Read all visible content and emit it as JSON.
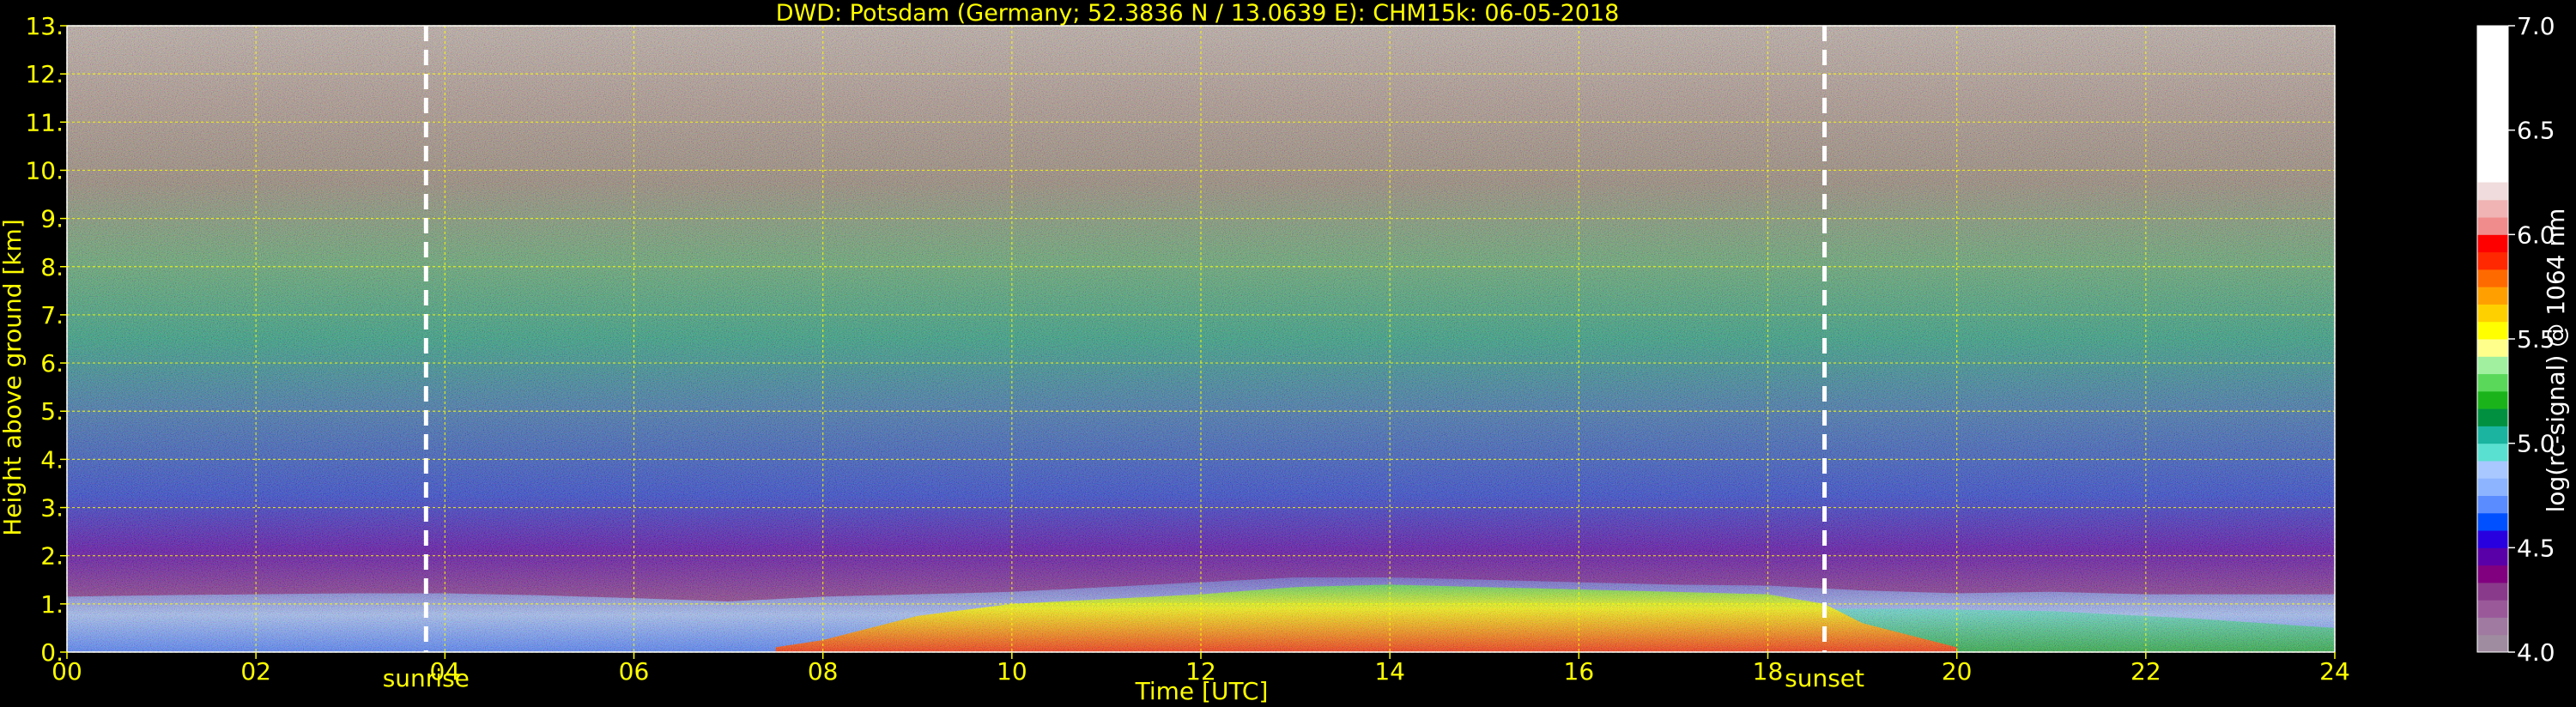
{
  "chart_data": {
    "type": "heatmap",
    "title": "DWD: Potsdam (Germany; 52.3836 N / 13.0639 E):    CHM15k: 06-05-2018",
    "xlabel": "Time [UTC]",
    "ylabel": "Height above ground [km]",
    "xlim": [
      0,
      24
    ],
    "ylim": [
      0,
      13
    ],
    "x_ticks": [
      "00",
      "02",
      "04",
      "06",
      "08",
      "10",
      "12",
      "14",
      "16",
      "18",
      "20",
      "22",
      "24"
    ],
    "y_ticks": [
      "0.",
      "1.",
      "2.",
      "3.",
      "4.",
      "5.",
      "6.",
      "7.",
      "8.",
      "9.",
      "10.",
      "11.",
      "12.",
      "13."
    ],
    "grid": true,
    "grid_color": "#ffff00",
    "events": [
      {
        "label": "sunrise",
        "time": 3.8
      },
      {
        "label": "sunset",
        "time": 18.6
      }
    ],
    "colorbar": {
      "label": "log(rc-signal) @ 1064 nm",
      "min": 4.0,
      "max": 7.0,
      "ticks": [
        "4.0",
        "4.5",
        "5.0",
        "5.5",
        "6.0",
        "6.5",
        "7.0"
      ],
      "colors": [
        "#a08ca0",
        "#a07aa0",
        "#9a5a9a",
        "#8a3a8a",
        "#800080",
        "#5a00a8",
        "#2800e0",
        "#0050ff",
        "#5a8cff",
        "#8cb4ff",
        "#a8c8ff",
        "#5ae0d0",
        "#1ab4a0",
        "#009040",
        "#1ab41a",
        "#5ad85a",
        "#a0f0a0",
        "#ffff8c",
        "#ffff00",
        "#ffd000",
        "#ffa000",
        "#ff6a00",
        "#ff2800",
        "#ff0000",
        "#f08c8c",
        "#f0b4b4",
        "#f0dcdc",
        "#ffffff"
      ]
    },
    "boundary_layer_top_km": [
      [
        0,
        1.15
      ],
      [
        1,
        1.18
      ],
      [
        2,
        1.2
      ],
      [
        3,
        1.22
      ],
      [
        4,
        1.22
      ],
      [
        5,
        1.18
      ],
      [
        6,
        1.12
      ],
      [
        7,
        1.05
      ],
      [
        8,
        1.15
      ],
      [
        9,
        1.2
      ],
      [
        10,
        1.25
      ],
      [
        11,
        1.35
      ],
      [
        12,
        1.45
      ],
      [
        13,
        1.55
      ],
      [
        14,
        1.55
      ],
      [
        15,
        1.5
      ],
      [
        16,
        1.45
      ],
      [
        17,
        1.4
      ],
      [
        18,
        1.38
      ],
      [
        19,
        1.28
      ],
      [
        20,
        1.22
      ],
      [
        21,
        1.25
      ],
      [
        22,
        1.2
      ],
      [
        23,
        1.2
      ],
      [
        24,
        1.2
      ]
    ],
    "mixing_layer_strong_signal_km": [
      [
        7.5,
        0.1
      ],
      [
        8,
        0.25
      ],
      [
        8.5,
        0.5
      ],
      [
        9,
        0.75
      ],
      [
        10,
        1.0
      ],
      [
        11,
        1.1
      ],
      [
        12,
        1.2
      ],
      [
        13,
        1.35
      ],
      [
        14,
        1.4
      ],
      [
        15,
        1.35
      ],
      [
        16,
        1.3
      ],
      [
        17,
        1.25
      ],
      [
        18,
        1.2
      ],
      [
        18.6,
        1.0
      ],
      [
        19,
        0.6
      ],
      [
        20,
        0.1
      ]
    ]
  }
}
